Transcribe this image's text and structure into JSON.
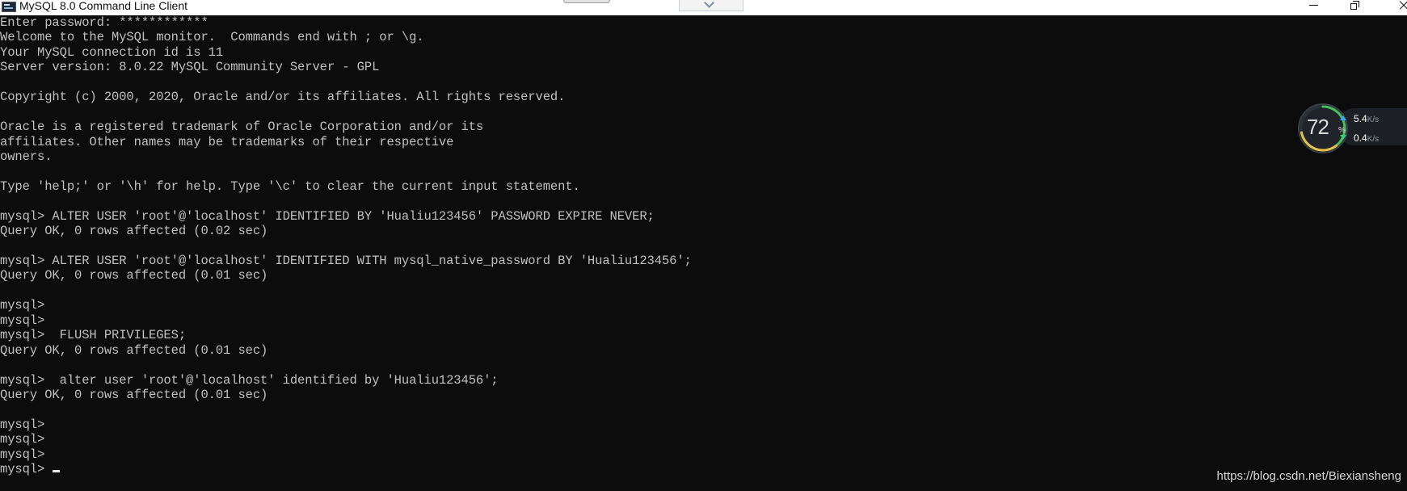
{
  "window": {
    "title": "MySQL 8.0 Command Line Client"
  },
  "console": {
    "lines": [
      "Enter password: ************",
      "Welcome to the MySQL monitor.  Commands end with ; or \\g.",
      "Your MySQL connection id is 11",
      "Server version: 8.0.22 MySQL Community Server - GPL",
      "",
      "Copyright (c) 2000, 2020, Oracle and/or its affiliates. All rights reserved.",
      "",
      "Oracle is a registered trademark of Oracle Corporation and/or its",
      "affiliates. Other names may be trademarks of their respective",
      "owners.",
      "",
      "Type 'help;' or '\\h' for help. Type '\\c' to clear the current input statement.",
      "",
      "mysql> ALTER USER 'root'@'localhost' IDENTIFIED BY 'Hualiu123456' PASSWORD EXPIRE NEVER;",
      "Query OK, 0 rows affected (0.02 sec)",
      "",
      "mysql> ALTER USER 'root'@'localhost' IDENTIFIED WITH mysql_native_password BY 'Hualiu123456';",
      "Query OK, 0 rows affected (0.01 sec)",
      "",
      "mysql>",
      "mysql>",
      "mysql>  FLUSH PRIVILEGES;",
      "Query OK, 0 rows affected (0.01 sec)",
      "",
      "mysql>  alter user 'root'@'localhost' identified by 'Hualiu123456';",
      "Query OK, 0 rows affected (0.01 sec)",
      "",
      "mysql>",
      "mysql>",
      "mysql>",
      "mysql>"
    ]
  },
  "network_monitor": {
    "cpu_percent": 72,
    "cpu_label": "72",
    "cpu_unit": "%",
    "upload_value": "5.4",
    "upload_unit": "K/s",
    "download_value": "0.4",
    "download_unit": "K/s",
    "colors": {
      "gauge_green": "#43c15a",
      "gauge_yellow": "#e3c24a",
      "upload": "#34a9ff",
      "download": "#34d06b"
    }
  },
  "watermark": "https://blog.csdn.net/Biexiansheng",
  "colors": {
    "console_bg": "#0c0c0c",
    "console_text": "#c0c0c0",
    "titlebar_bg": "#ffffff"
  }
}
